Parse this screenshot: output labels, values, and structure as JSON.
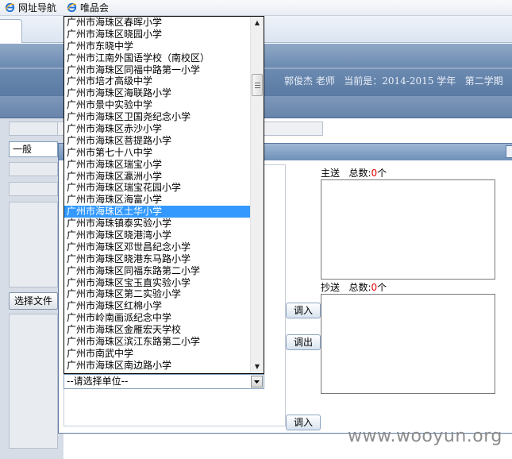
{
  "favorites": [
    {
      "label": "网址导航",
      "icon": "ie-icon"
    },
    {
      "label": "唯品会",
      "icon": "ie-icon"
    }
  ],
  "header": {
    "user_info": "郭俊杰 老师   当前是：2014-2015 学年   第二学期"
  },
  "form": {
    "category_value": "一般",
    "choose_file_label": "选择文件"
  },
  "dialog": {
    "send_label": "主送",
    "send_total_label": "总数:",
    "send_count": "0",
    "send_unit": "个",
    "cc_label": "抄送",
    "cc_total_label": "总数:",
    "cc_count": "0",
    "cc_unit": "个",
    "import_label": "调入",
    "export_label": "调出",
    "import2_label": "调入"
  },
  "unit_select": {
    "placeholder": "--请选择单位--",
    "selected_index": 16,
    "options": [
      "广州市海珠区春晖小学",
      "广州市海珠区晓园小学",
      "广州市东晓中学",
      "广州市江南外国语学校（南校区）",
      "广州市海珠区同福中路第一小学",
      "广州市培才高级中学",
      "广州市海珠区海联路小学",
      "广州市景中实验中学",
      "广州市海珠区卫国尧纪念小学",
      "广州市海珠区赤沙小学",
      "广州市海珠区菩提路小学",
      "广州市第七十八中学",
      "广州市海珠区瑞宝小学",
      "广州市海珠区瀛洲小学",
      "广州市海珠区瑞宝花园小学",
      "广州市海珠区海富小学",
      "广州市海珠区土华小学",
      "广州市海珠镇泰实验小学",
      "广州市海珠区晓港湾小学",
      "广州市海珠区邓世昌纪念小学",
      "广州市海珠区晓港东马路小学",
      "广州市海珠区同福东路第二小学",
      "广州市海珠区宝玉直实验小学",
      "广州市海珠区第二实验小学",
      "广州市海珠区红棉小学",
      "广州市岭南画派纪念中学",
      "广州市海珠区金雁宏天学校",
      "广州市海珠区滨江东路第二小学",
      "广州市南武中学",
      "广州市海珠区南边路小学"
    ]
  },
  "watermark": "www.wooyun.org",
  "colors": {
    "selection": "#3399ff",
    "count_red": "#e00000",
    "header_blue": "#6f8db3"
  }
}
